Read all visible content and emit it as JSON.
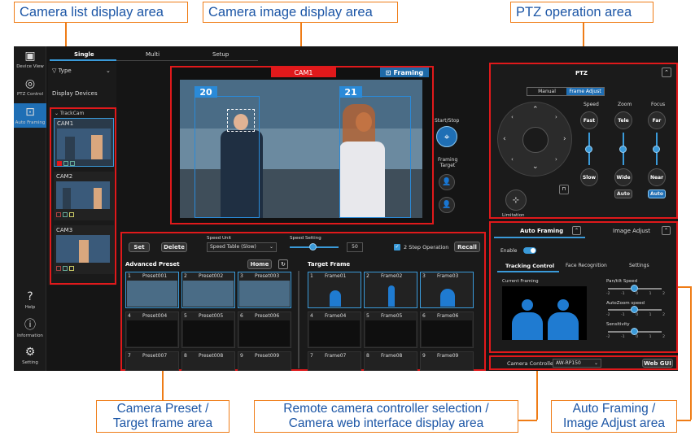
{
  "callouts": {
    "camera_list": "Camera list display area",
    "camera_image": "Camera image display area",
    "ptz": "PTZ operation area",
    "preset": "Camera Preset / Target frame area",
    "remote": "Remote camera controller selection / Camera web interface display area",
    "auto_framing": "Auto Framing / Image Adjust area"
  },
  "sidebar": {
    "items": [
      {
        "label": "Device View",
        "icon": "device-view-icon"
      },
      {
        "label": "PTZ Control",
        "icon": "ptz-control-icon"
      },
      {
        "label": "Auto Framing",
        "icon": "auto-framing-icon"
      },
      {
        "label": "Help",
        "icon": "help-icon"
      },
      {
        "label": "Information",
        "icon": "info-icon"
      },
      {
        "label": "Setting",
        "icon": "gear-icon"
      }
    ]
  },
  "tabs": [
    "Single",
    "Multi",
    "Setup"
  ],
  "camera_list": {
    "type_label": "Type",
    "display_devices": "Display Devices",
    "group": "TrackCam",
    "cameras": [
      "CAM1",
      "CAM2",
      "CAM3"
    ]
  },
  "viewer": {
    "camera_name": "CAM1",
    "framing_label": "Framing",
    "box_labels": [
      "20",
      "21"
    ],
    "start_stop": "Start/Stop",
    "framing_target": "Framing Target"
  },
  "ptz": {
    "title": "PTZ",
    "mode_tabs": [
      "Manual",
      "Frame Adjust"
    ],
    "speed": {
      "label": "Speed",
      "top": "Fast",
      "bottom": "Slow"
    },
    "zoom": {
      "label": "Zoom",
      "top": "Tele",
      "bottom": "Wide",
      "auto": "Auto"
    },
    "focus": {
      "label": "Focus",
      "top": "Far",
      "bottom": "Near",
      "auto": "Auto"
    },
    "limitation": "Limitation"
  },
  "preset": {
    "set": "Set",
    "delete": "Delete",
    "speed_unit_label": "Speed Unit",
    "speed_unit_value": "Speed Table (Slow)",
    "speed_setting_label": "Speed Setting",
    "speed_value": "50",
    "two_step": "2 Step Operation",
    "recall": "Recall",
    "advanced_title": "Advanced Preset",
    "home": "Home",
    "target_title": "Target Frame",
    "presets": [
      {
        "num": "1",
        "name": "Preset001"
      },
      {
        "num": "2",
        "name": "Preset002"
      },
      {
        "num": "3",
        "name": "Preset003"
      },
      {
        "num": "4",
        "name": "Preset004"
      },
      {
        "num": "5",
        "name": "Preset005"
      },
      {
        "num": "6",
        "name": "Preset006"
      },
      {
        "num": "7",
        "name": "Preset007"
      },
      {
        "num": "8",
        "name": "Preset008"
      },
      {
        "num": "9",
        "name": "Preset009"
      }
    ],
    "frames": [
      {
        "num": "1",
        "name": "Frame01"
      },
      {
        "num": "2",
        "name": "Frame02"
      },
      {
        "num": "3",
        "name": "Frame03"
      },
      {
        "num": "4",
        "name": "Frame04"
      },
      {
        "num": "5",
        "name": "Frame05"
      },
      {
        "num": "6",
        "name": "Frame06"
      },
      {
        "num": "7",
        "name": "Frame07"
      },
      {
        "num": "8",
        "name": "Frame08"
      },
      {
        "num": "9",
        "name": "Frame09"
      }
    ]
  },
  "autoframing": {
    "tabs": [
      "Auto Framing",
      "Image Adjust"
    ],
    "enable": "Enable",
    "subtabs": [
      "Tracking Control",
      "Face Recognition",
      "Settings"
    ],
    "current_framing": "Current Framing",
    "sliders": [
      {
        "label": "Pan/tilt Speed",
        "level": 0.5
      },
      {
        "label": "AutoZoom speed",
        "level": 0.5
      },
      {
        "label": "Sensitivity",
        "level": 0.5
      }
    ],
    "scale": [
      "-2",
      "-1",
      "0",
      "1",
      "2"
    ]
  },
  "controller": {
    "label": "Camera Controller",
    "value": "AW-RP150",
    "web_gui": "Web GUI"
  },
  "colors": {
    "accent": "#3a9ad9",
    "highlight": "#e0191b",
    "callout_border": "#ef7c16",
    "callout_text": "#1c56a6"
  }
}
